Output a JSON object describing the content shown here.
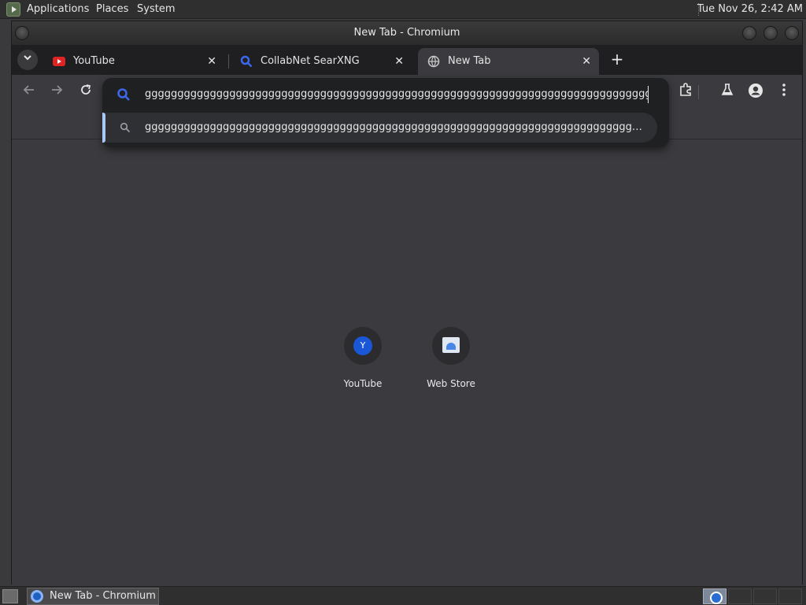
{
  "panel": {
    "menus": [
      "Applications",
      "Places",
      "System"
    ],
    "clock": "Tue Nov 26,  2:42 AM"
  },
  "window": {
    "title": "New Tab - Chromium"
  },
  "tabs": [
    {
      "label": "YouTube",
      "icon": "youtube-icon"
    },
    {
      "label": "CollabNet SearXNG",
      "icon": "search-icon"
    },
    {
      "label": "New Tab",
      "icon": "globe-icon",
      "active": true
    }
  ],
  "omnibox": {
    "value": "ggggggggggggggggggggggggggggggggggggggggggggggggggggggggggggggggggggggggggggggggg",
    "suggestion": "ggggggggggggggggggggggggggggggggggggggggggggggggggggggggggggggggggggggggggggggggg..."
  },
  "shortcuts": [
    {
      "label": "YouTube",
      "letter": "Y"
    },
    {
      "label": "Web Store"
    }
  ],
  "taskbar": {
    "item_label": "New Tab - Chromium"
  },
  "colors": {
    "accent": "#a8c7fa",
    "search_icon": "#3b67e8",
    "youtube": "#e02424"
  }
}
